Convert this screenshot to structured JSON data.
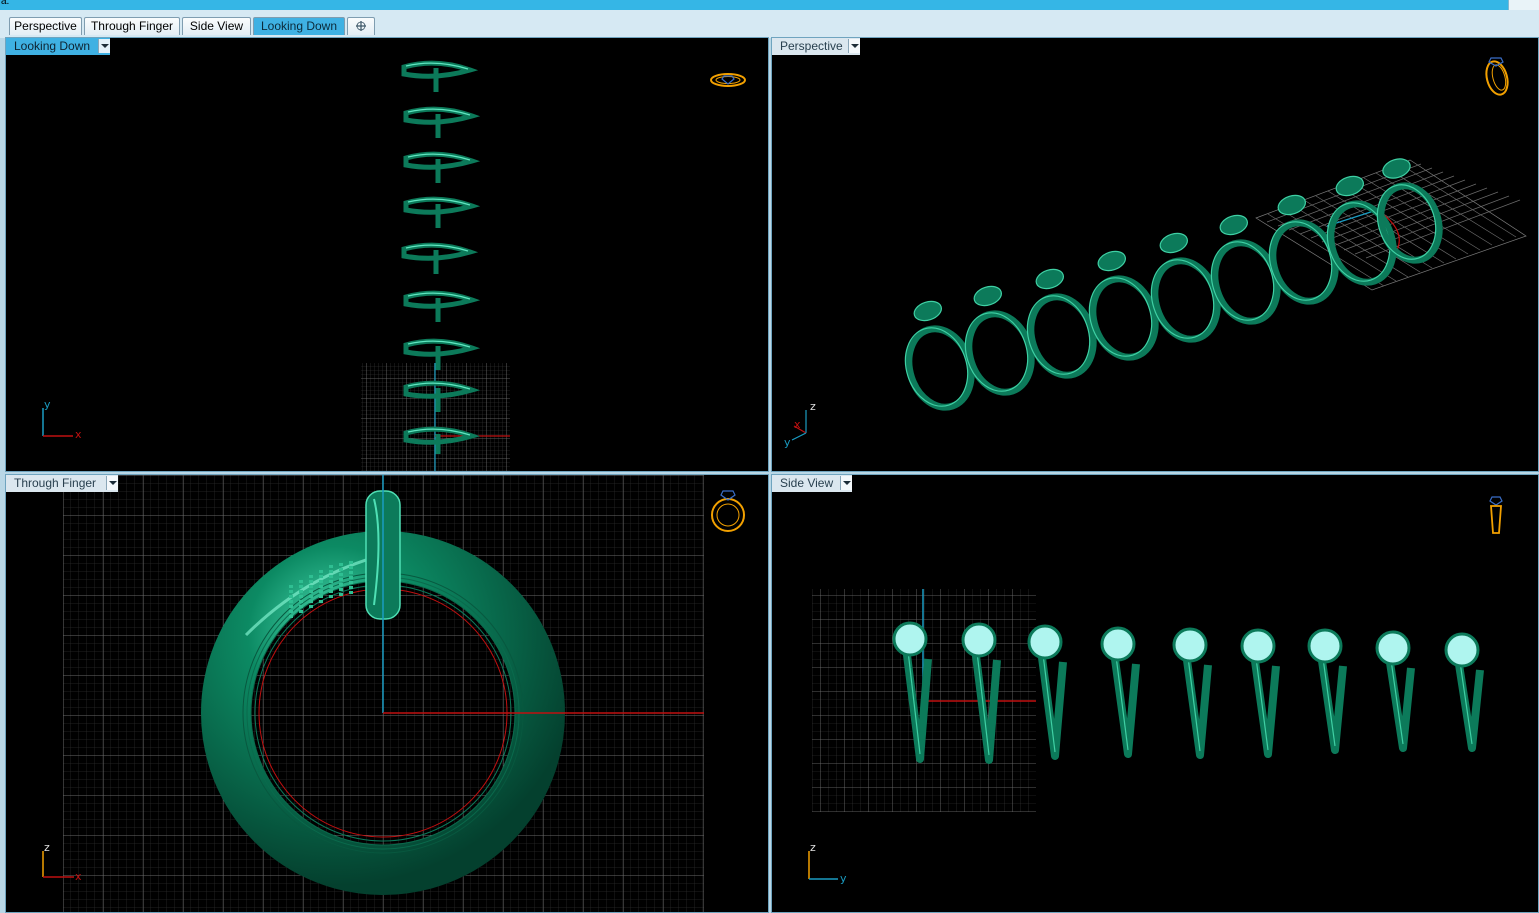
{
  "titlebar": {
    "glyph": "a."
  },
  "tabs": [
    {
      "label": "Perspective",
      "active": false
    },
    {
      "label": "Through Finger",
      "active": false
    },
    {
      "label": "Side View",
      "active": false
    },
    {
      "label": "Looking Down",
      "active": true
    }
  ],
  "add_tab_icon": "add-tab-icon",
  "viewports": {
    "looking_down": {
      "label": "Looking Down",
      "active": true,
      "axis_a": "y",
      "axis_b": "x"
    },
    "perspective": {
      "label": "Perspective",
      "active": false,
      "axis_a": "z",
      "axis_b": "x",
      "axis_c": "y"
    },
    "through_finger": {
      "label": "Through Finger",
      "active": false,
      "axis_a": "z",
      "axis_b": "x"
    },
    "side_view": {
      "label": "Side View",
      "active": false,
      "axis_a": "z",
      "axis_b": "y"
    }
  },
  "colors": {
    "ring": "#0c7a5a",
    "ring_highlight": "#4fe0b5",
    "gem": "#aff5ef",
    "grid": "#5a5a5a",
    "axis_x": "#c01010",
    "axis_y": "#1a9cc2",
    "nav_icon": "#f2a000"
  },
  "icons": [
    "ring-top-icon",
    "ring-perspective-icon",
    "ring-front-icon",
    "ring-side-icon"
  ]
}
